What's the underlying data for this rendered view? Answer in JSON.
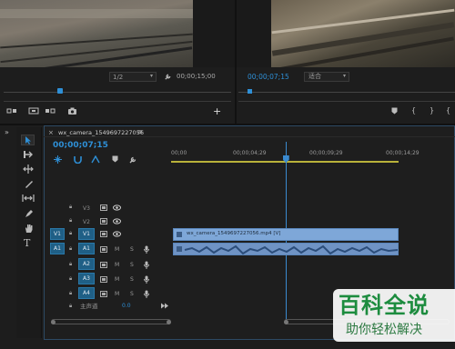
{
  "source_monitor": {
    "zoom": "1/2",
    "timecode": "00;00;15;00"
  },
  "program_monitor": {
    "timecode": "00;00;07;15",
    "fit": "适合"
  },
  "timeline": {
    "panel_tab": "wx_camera_1549697227056",
    "timecode": "00;00;07;15",
    "ruler_labels": [
      "00;00",
      "00;00;04;29",
      "00;00;09;29",
      "00;00;14;29"
    ],
    "video_tracks": [
      {
        "name": "V3",
        "source": ""
      },
      {
        "name": "V2",
        "source": ""
      },
      {
        "name": "V1",
        "source": "V1"
      }
    ],
    "audio_tracks": [
      {
        "name": "A1",
        "source": "A1",
        "m": "M",
        "s": "S"
      },
      {
        "name": "A2",
        "source": "",
        "m": "M",
        "s": "S"
      },
      {
        "name": "A3",
        "source": "",
        "m": "M",
        "s": "S"
      },
      {
        "name": "A4",
        "source": "",
        "m": "M",
        "s": "S"
      }
    ],
    "master": {
      "label": "主声道",
      "value": "0.0"
    },
    "video_clip": "wx_camera_1549697227056.mp4 [V]",
    "playhead_fraction": 0.503
  },
  "watermark": {
    "title": "百科全说",
    "subtitle": "助你轻松解决"
  },
  "colors": {
    "accent_blue": "#2e8fd6",
    "clip_blue": "#7ea7d8",
    "track_blue": "#1f5f86",
    "playhead": "#3a8ad0",
    "watermark_green": "#1d8c3f"
  }
}
